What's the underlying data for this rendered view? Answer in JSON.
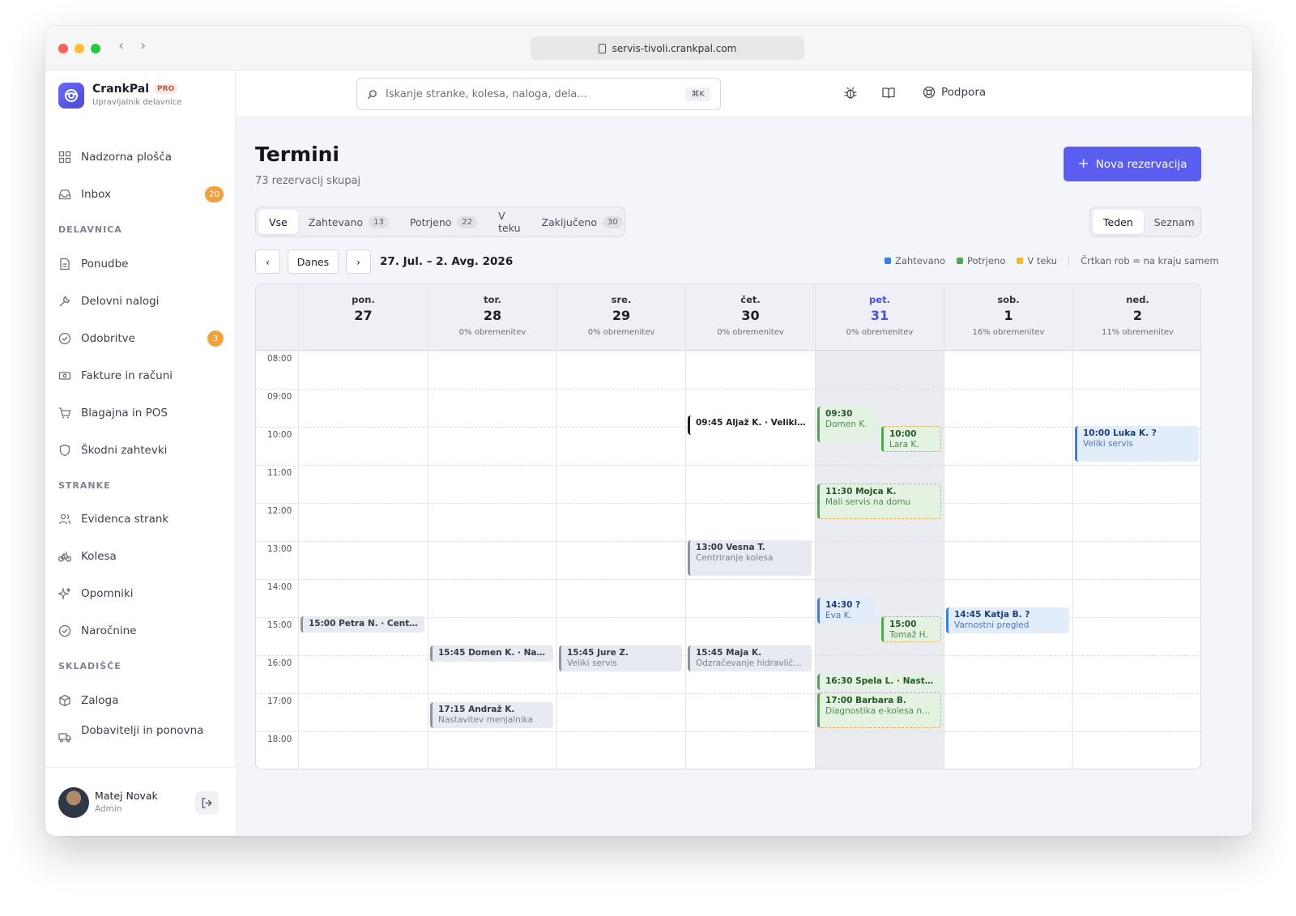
{
  "browser": {
    "url": "servis-tivoli.crankpal.com"
  },
  "brand": {
    "name": "CrankPal",
    "tier": "PRO",
    "subtitle": "Upravljalnik delavnice"
  },
  "sidebar": {
    "items": [
      {
        "label": "Nadzorna plošča"
      },
      {
        "label": "Inbox",
        "badge": "20"
      },
      {
        "label": "Ponudbe"
      },
      {
        "label": "Delovni nalogi"
      },
      {
        "label": "Odobritve",
        "badge": "3"
      },
      {
        "label": "Fakture in računi"
      },
      {
        "label": "Blagajna in POS"
      },
      {
        "label": "Škodni zahtevki"
      },
      {
        "label": "Evidenca strank"
      },
      {
        "label": "Kolesa"
      },
      {
        "label": "Opomniki"
      },
      {
        "label": "Naročnine"
      },
      {
        "label": "Zaloga"
      },
      {
        "label": "Dobavitelji in ponovna"
      }
    ],
    "sections": [
      "DELAVNICA",
      "STRANKE",
      "SKLADIŠČE"
    ]
  },
  "user": {
    "name": "Matej Novak",
    "role": "Admin"
  },
  "topbar": {
    "search_placeholder": "Iskanje stranke, kolesa, naloga, dela...",
    "shortcut": "⌘K",
    "support": "Podpora"
  },
  "page": {
    "title": "Termini",
    "subtitle": "73 rezervacij skupaj",
    "new_button": "Nova rezervacija"
  },
  "filters": [
    {
      "label": "Vse",
      "count": ""
    },
    {
      "label": "Zahtevano",
      "count": "13"
    },
    {
      "label": "Potrjeno",
      "count": "22"
    },
    {
      "label": "V teku",
      "count": ""
    },
    {
      "label": "Zaključeno",
      "count": "30"
    }
  ],
  "view": {
    "week": "Teden",
    "list": "Seznam"
  },
  "calnav": {
    "prev": "‹",
    "today": "Danes",
    "next": "›",
    "range": "27. Jul. – 2. Avg. 2026"
  },
  "legend": {
    "requested": "Zahtevano",
    "confirmed": "Potrjeno",
    "in_progress": "V teku",
    "note": "Črtkan rob = na kraju samem"
  },
  "colors": {
    "requested": "#3b7fe0",
    "confirmed": "#4ea84d",
    "in_progress": "#f2b733",
    "accent": "#5a5ef0"
  },
  "days": [
    {
      "name": "pon.",
      "date": "27",
      "load": ""
    },
    {
      "name": "tor.",
      "date": "28",
      "load": "0% obremenitev"
    },
    {
      "name": "sre.",
      "date": "29",
      "load": "0% obremenitev"
    },
    {
      "name": "čet.",
      "date": "30",
      "load": "0% obremenitev"
    },
    {
      "name": "pet.",
      "date": "31",
      "load": "0% obremenitev"
    },
    {
      "name": "sob.",
      "date": "1",
      "load": "16% obremenitev"
    },
    {
      "name": "ned.",
      "date": "2",
      "load": "11% obremenitev"
    }
  ],
  "hours": [
    "08:00",
    "09:00",
    "10:00",
    "11:00",
    "12:00",
    "13:00",
    "14:00",
    "15:00",
    "16:00",
    "17:00",
    "18:00"
  ],
  "events": [
    {
      "title": "09:45 Aljaž K. · Veliki ser...",
      "sub": ""
    },
    {
      "title": "09:30",
      "sub": "Domen K."
    },
    {
      "title": "10:00",
      "sub": "Lara K."
    },
    {
      "title": "10:00 Luka K. ?",
      "sub": "Veliki servis"
    },
    {
      "title": "11:30 Mojca K.",
      "sub": "Mali servis na domu"
    },
    {
      "title": "13:00 Vesna T.",
      "sub": "Centriranje kolesa"
    },
    {
      "title": "14:30 ?",
      "sub": "Eva K."
    },
    {
      "title": "14:45 Katja B. ?",
      "sub": "Varnostni pregled"
    },
    {
      "title": "15:00 Petra N. · Centriran...",
      "sub": ""
    },
    {
      "title": "15:00",
      "sub": "Tomaž H."
    },
    {
      "title": "15:45 Domen K. · Nastavi...",
      "sub": ""
    },
    {
      "title": "15:45 Jure Z.",
      "sub": "Veliki servis"
    },
    {
      "title": "15:45 Maja K.",
      "sub": "Odzračevanje hidravličnih ..."
    },
    {
      "title": "16:30 Špela L. · Nastavite...",
      "sub": ""
    },
    {
      "title": "17:00 Barbara B.",
      "sub": "Diagnostika e-kolesa na d..."
    },
    {
      "title": "17:15 Andraž K.",
      "sub": "Nastavitev menjalnika"
    }
  ]
}
